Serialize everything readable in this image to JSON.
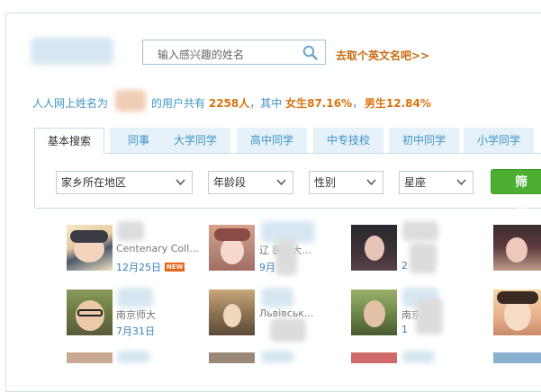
{
  "search": {
    "placeholder": "输入感兴趣的姓名",
    "english_name_link": "去取个英文名吧>>"
  },
  "stats": {
    "prefix": "人人网上姓名为",
    "middle": "的用户共有",
    "count": "2258人",
    "among": "，其中",
    "female": "女生87.16%",
    "sep": "，",
    "male": "男生12.84%"
  },
  "tabs": [
    {
      "label": "基本搜索",
      "active": true
    },
    {
      "label": "同事"
    },
    {
      "label": "大学同学"
    },
    {
      "label": "高中同学"
    },
    {
      "label": "中专技校"
    },
    {
      "label": "初中同学"
    },
    {
      "label": "小学同学"
    }
  ],
  "filters": {
    "hometown": "家乡所在地区",
    "age": "年龄段",
    "gender": "性别",
    "zodiac": "星座",
    "button": "筛 选"
  },
  "users": [
    {
      "school": "Centenary Coll...",
      "date": "12月25日",
      "badge": "NEW"
    },
    {
      "school": "辽    医科大...",
      "date": "9月"
    },
    {
      "school": "",
      "date": "2"
    },
    {
      "school": "南京师大",
      "date": "7月31日"
    },
    {
      "school": "Львівськ...",
      "date": ""
    },
    {
      "school": "南京",
      "date": "1"
    }
  ],
  "colors": {
    "accent": "#3b94c5",
    "highlight": "#d9730f",
    "button": "#4caf32",
    "badge": "#e8661a"
  }
}
